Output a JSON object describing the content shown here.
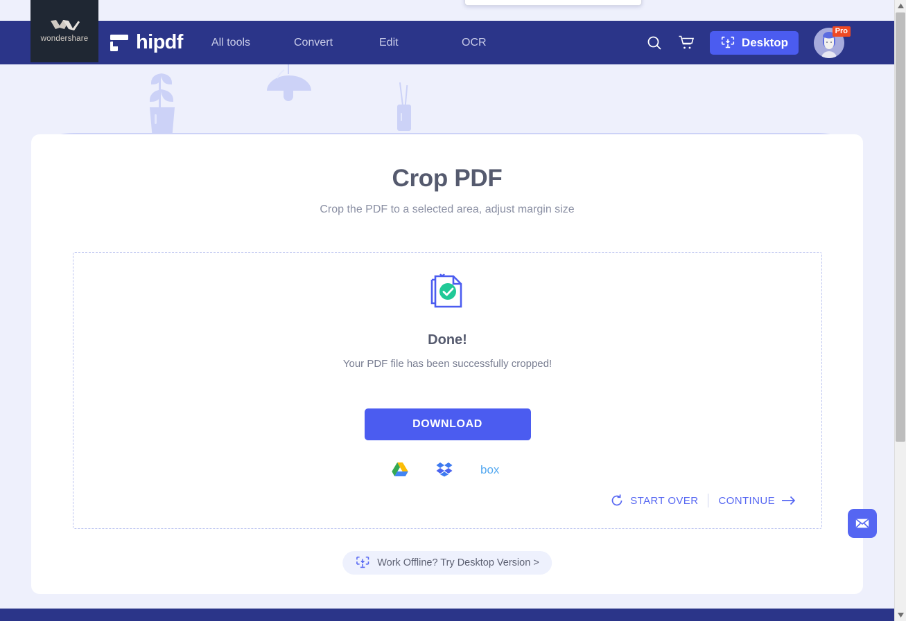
{
  "colors": {
    "nav_bg": "#2b3589",
    "accent_blue": "#4b5cf0",
    "link_blue": "#5566f2",
    "page_bg": "#eef0fc",
    "card_bg": "#ffffff",
    "success_green": "#20c997",
    "pro_badge": "#ef4a24",
    "dashed_border": "#bcc4f0",
    "illustration": "#ccd2f7"
  },
  "navbar": {
    "wondershare_label": "wondershare",
    "brand": "hipdf",
    "links": [
      {
        "label": "All tools"
      },
      {
        "label": "Convert"
      },
      {
        "label": "Edit"
      },
      {
        "label": "OCR"
      }
    ],
    "search_icon": "search-icon",
    "cart_icon": "cart-icon",
    "desktop_button": "Desktop",
    "pro_badge": "Pro"
  },
  "main": {
    "title": "Crop PDF",
    "subtitle": "Crop the PDF to a selected area, adjust margin size",
    "result": {
      "icon": "document-check-icon",
      "heading": "Done!",
      "message": "Your PDF file has been successfully cropped!"
    },
    "download_button": "DOWNLOAD",
    "cloud_targets": [
      {
        "name": "google-drive",
        "label": "Google Drive"
      },
      {
        "name": "dropbox",
        "label": "Dropbox"
      },
      {
        "name": "box",
        "label": "Box"
      }
    ],
    "actions": {
      "start_over": "START OVER",
      "continue": "CONTINUE"
    },
    "offline_button": "Work Offline? Try Desktop Version >"
  },
  "fab": {
    "mail_icon": "envelope-icon"
  },
  "scrollbar": {
    "up_arrow": "▲",
    "down_arrow": "▼"
  }
}
